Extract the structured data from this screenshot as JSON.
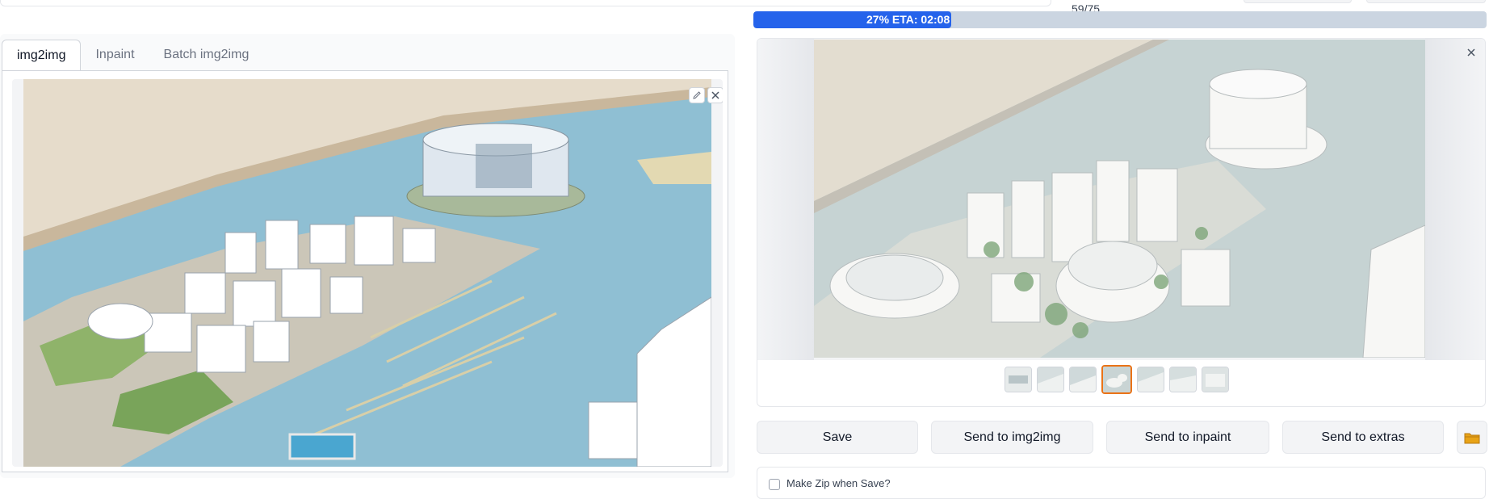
{
  "progress": {
    "text": "27% ETA: 02:08",
    "fraction": 0.27
  },
  "step_counter": "59/75",
  "tabs": [
    {
      "label": "img2img",
      "active": true
    },
    {
      "label": "Inpaint",
      "active": false
    },
    {
      "label": "Batch img2img",
      "active": false
    }
  ],
  "input_image": {
    "icons": [
      "pencil-icon",
      "close-icon"
    ]
  },
  "output_gallery": {
    "selected_index": 3,
    "thumbnail_count": 7
  },
  "actions": {
    "save": "Save",
    "send_img2img": "Send to img2img",
    "send_inpaint": "Send to inpaint",
    "send_extras": "Send to extras"
  },
  "folder_icon": "folder-icon",
  "zip": {
    "label": "Make Zip when Save?",
    "checked": false
  },
  "colors": {
    "accent": "#2563eb",
    "selected_thumb": "#ea7317",
    "folder": "#e8a317"
  }
}
